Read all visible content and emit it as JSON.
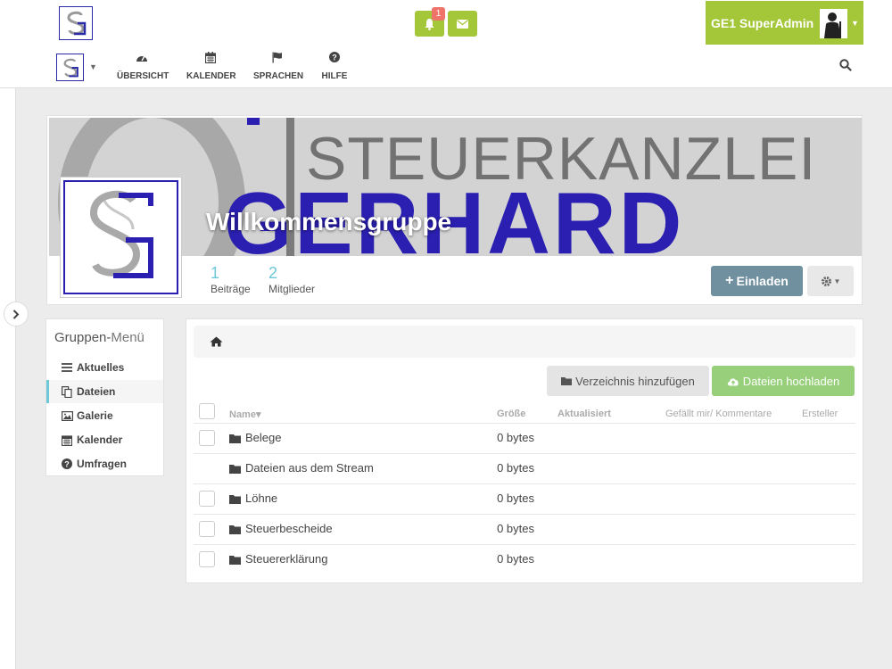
{
  "header": {
    "notification_count": "1",
    "user_name": "GE1 SuperAdmin"
  },
  "nav": [
    {
      "label": "ÜBERSICHT",
      "icon": "dashboard-icon"
    },
    {
      "label": "KALENDER",
      "icon": "calendar-icon"
    },
    {
      "label": "SPRACHEN",
      "icon": "flag-icon"
    },
    {
      "label": "HILFE",
      "icon": "question-circle-icon"
    }
  ],
  "banner": {
    "line1": "STEUERKANZLEI",
    "line2": "GERHARD"
  },
  "group": {
    "title": "Willkommensgruppe",
    "stats": [
      {
        "value": "1",
        "label": "Beiträge"
      },
      {
        "value": "2",
        "label": "Mitglieder"
      }
    ],
    "invite_label": "Einladen"
  },
  "group_menu": {
    "title_main": "Gruppen-",
    "title_accent": "Menü",
    "items": [
      {
        "label": "Aktuelles",
        "icon": "list-icon"
      },
      {
        "label": "Dateien",
        "icon": "files-icon",
        "active": true
      },
      {
        "label": "Galerie",
        "icon": "image-icon"
      },
      {
        "label": "Kalender",
        "icon": "calendar-icon"
      },
      {
        "label": "Umfragen",
        "icon": "question-circle-icon"
      }
    ]
  },
  "files": {
    "add_dir_label": "Verzeichnis hinzufügen",
    "upload_label": "Dateien hochladen",
    "columns": {
      "name": "Name▾",
      "size": "Größe",
      "updated": "Aktualisiert",
      "likes": "Gefällt mir/ Kommentare",
      "creator": "Ersteller"
    },
    "rows": [
      {
        "name": "Belege",
        "size": "0 bytes",
        "checkbox": true
      },
      {
        "name": "Dateien aus dem Stream",
        "size": "0 bytes",
        "checkbox": false
      },
      {
        "name": "Löhne",
        "size": "0 bytes",
        "checkbox": true
      },
      {
        "name": "Steuerbescheide",
        "size": "0 bytes",
        "checkbox": true
      },
      {
        "name": "Steuererklärung",
        "size": "0 bytes",
        "checkbox": true
      }
    ]
  },
  "colors": {
    "accent_green": "#a4c639",
    "stat_blue": "#6fc8d8",
    "brand_blue": "#2a1fb0"
  }
}
